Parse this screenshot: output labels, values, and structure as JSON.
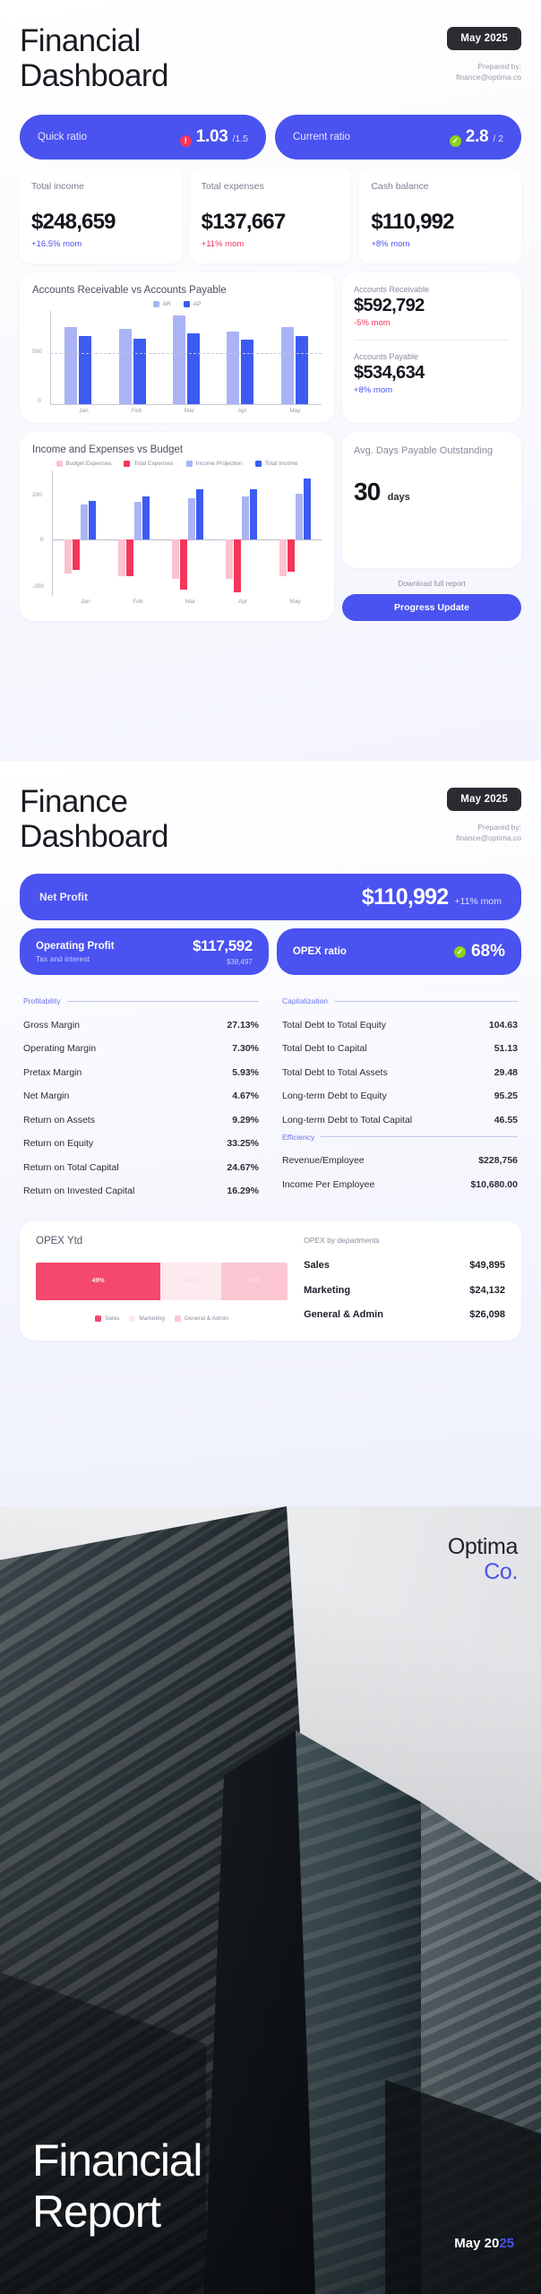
{
  "page1": {
    "title": "Financial\nDashboard",
    "date_pill": "May 2025",
    "prepared_by": "Prepared by:\nfinance@optima.co",
    "ratios": [
      {
        "label": "Quick ratio",
        "value": "1.03",
        "target": "/1.5",
        "status": "warning",
        "icon": "alert-icon"
      },
      {
        "label": "Current ratio",
        "value": "2.8",
        "target": "/ 2",
        "status": "ok",
        "icon": "check-icon"
      }
    ],
    "stats": [
      {
        "label": "Total income",
        "value": "$248,659",
        "delta": "+16.5% mom",
        "trend": "up"
      },
      {
        "label": "Total expenses",
        "value": "$137,667",
        "delta": "+11% mom",
        "trend": "down"
      },
      {
        "label": "Cash balance",
        "value": "$110,992",
        "delta": "+8% mom",
        "trend": "up"
      }
    ],
    "ar_ap_summary": [
      {
        "label": "Accounts Receivable",
        "value": "$592,792",
        "delta": "-5% mom",
        "trend": "down"
      },
      {
        "label": "Accounts Payable",
        "value": "$534,634",
        "delta": "+8% mom",
        "trend": "up"
      }
    ],
    "dpo": {
      "label": "Avg. Days Payable Outstanding",
      "value": "30",
      "unit": "days"
    },
    "download_text": "Download full report",
    "cta_label": "Progress Update"
  },
  "page2": {
    "title": "Finance\nDashboard",
    "date_pill": "May 2025",
    "prepared_by": "Prepared by:\nfinance@optima.co",
    "net_profit": {
      "label": "Net Profit",
      "value": "$110,992",
      "delta": "+11% mom"
    },
    "operating_profit": {
      "label": "Operating Profit",
      "value": "$117,592",
      "sub_label": "Tax and interest",
      "sub_value": "$38,497"
    },
    "opex_ratio": {
      "label": "OPEX ratio",
      "value": "68%",
      "status": "ok",
      "icon": "check-icon"
    },
    "sections": [
      {
        "name": "Profitability",
        "rows": [
          {
            "name": "Gross Margin",
            "value": "27.13%"
          },
          {
            "name": "Operating Margin",
            "value": "7.30%"
          },
          {
            "name": "Pretax Margin",
            "value": "5.93%"
          },
          {
            "name": "Net Margin",
            "value": "4.67%"
          },
          {
            "name": "Return on Assets",
            "value": "9.29%"
          },
          {
            "name": "Return on Equity",
            "value": "33.25%"
          },
          {
            "name": "Return on Total Capital",
            "value": "24.67%"
          },
          {
            "name": "Return on Invested Capital",
            "value": "16.29%"
          }
        ]
      },
      {
        "name": "Capitalization",
        "rows": [
          {
            "name": "Total Debt to Total Equity",
            "value": "104.63"
          },
          {
            "name": "Total Debt to Capital",
            "value": "51.13"
          },
          {
            "name": "Total Debt to Total Assets",
            "value": "29.48"
          },
          {
            "name": "Long-term Debt to Equity",
            "value": "95.25"
          },
          {
            "name": "Long-term Debt to Total Capital",
            "value": "46.55"
          }
        ]
      },
      {
        "name": "Efficiency",
        "rows": [
          {
            "name": "Revenue/Employee",
            "value": "$228,756"
          },
          {
            "name": "Income Per Employee",
            "value": "$10,680.00"
          }
        ]
      }
    ],
    "opex_card": {
      "title": "OPEX Ytd",
      "dept_header": "OPEX by departments",
      "departments": [
        {
          "name": "Sales",
          "value": "$49,895"
        },
        {
          "name": "Marketing",
          "value": "$24,132"
        },
        {
          "name": "General & Admin",
          "value": "$26,098"
        }
      ]
    }
  },
  "cover": {
    "brand_line1": "Optima",
    "brand_line2": "Co.",
    "title": "Financial\nReport",
    "date_prefix": "May 20",
    "date_accent": "25"
  },
  "colors": {
    "accent": "#4a52f0",
    "accent_light": "#aab4f5",
    "pink": "#f5365c",
    "pink_light": "#fbc3cf",
    "green": "#8cd219",
    "text_dark": "#15151d",
    "muted": "#8a8a9c"
  },
  "chart_data": [
    {
      "type": "bar",
      "title": "Accounts Receivable vs Accounts Payable",
      "categories": [
        "Jan",
        "Feb",
        "Mar",
        "Apr",
        "May"
      ],
      "series": [
        {
          "name": "AR",
          "color": "#aab4f5",
          "values": [
            590,
            580,
            680,
            560,
            595
          ]
        },
        {
          "name": "AP",
          "color": "#3d5bf0",
          "values": [
            525,
            500,
            545,
            497,
            522
          ]
        }
      ],
      "ytick_labels": [
        "500",
        "0"
      ],
      "ylim": [
        0,
        720
      ],
      "gridline_at": 500,
      "xlabel": "",
      "ylabel": "",
      "legend_position": "top-center",
      "grid": true
    },
    {
      "type": "bar",
      "title": "Income and Expenses vs Budget",
      "categories": [
        "Jan",
        "Feb",
        "Mar",
        "Apr",
        "May"
      ],
      "series": [
        {
          "name": "Budget Expenses",
          "color": "#fbc3cf",
          "values": [
            -118,
            -128,
            -140,
            -138,
            -130
          ]
        },
        {
          "name": "Total Expenses",
          "color": "#f5365c",
          "values": [
            -108,
            -130,
            -175,
            -185,
            -112
          ]
        },
        {
          "name": "Income Projection",
          "color": "#aab4f5",
          "values": [
            132,
            142,
            155,
            163,
            175
          ]
        },
        {
          "name": "Total Income",
          "color": "#3d5bf0",
          "values": [
            145,
            163,
            192,
            190,
            232
          ]
        }
      ],
      "ytick_labels": [
        "200",
        "0",
        "-200"
      ],
      "ylim": [
        -200,
        260
      ],
      "xlabel": "",
      "ylabel": "",
      "legend_position": "top-center",
      "grid": false
    },
    {
      "type": "bar",
      "title": "OPEX Ytd",
      "orientation": "horizontal-stacked",
      "categories": [
        "Sales",
        "Marketing",
        "General & Admin"
      ],
      "values": [
        49,
        24,
        26
      ],
      "labels": [
        "49%",
        "24%",
        "26%"
      ],
      "colors": [
        "#f5486e",
        "#fdeaee",
        "#fbc6d2"
      ],
      "legend_position": "bottom-center",
      "grid": false
    }
  ]
}
